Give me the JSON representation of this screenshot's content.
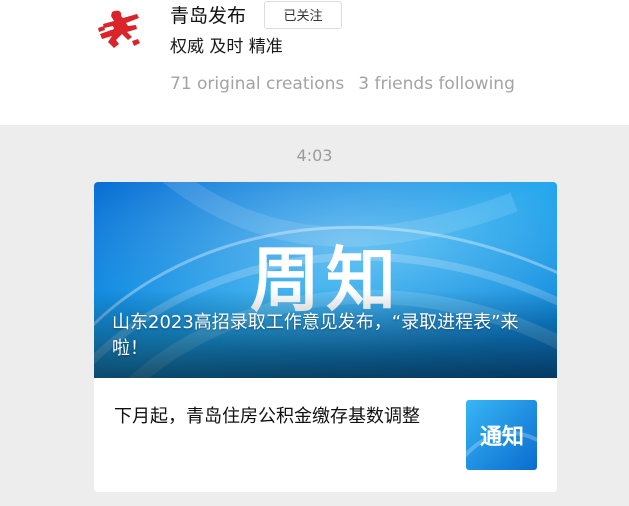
{
  "account": {
    "name": "青岛发布",
    "follow_label": "已关注",
    "slogan": "权威 及时 精准",
    "stats": {
      "original_creations": "71 original creations",
      "friends_following": "3 friends following"
    },
    "avatar_icon": "qingdao-logo-icon",
    "brand_color": "#d9242a"
  },
  "message": {
    "time": "4:03",
    "articles": [
      {
        "title": "山东2023高招录取工作意见发布，“录取进程表”来啦！",
        "cover_text": "周知",
        "cover_color": "#1a9be6"
      },
      {
        "title": "下月起，青岛住房公积金缴存基数调整",
        "thumb_text": "通知",
        "thumb_color": "#1c8fe0"
      }
    ]
  }
}
